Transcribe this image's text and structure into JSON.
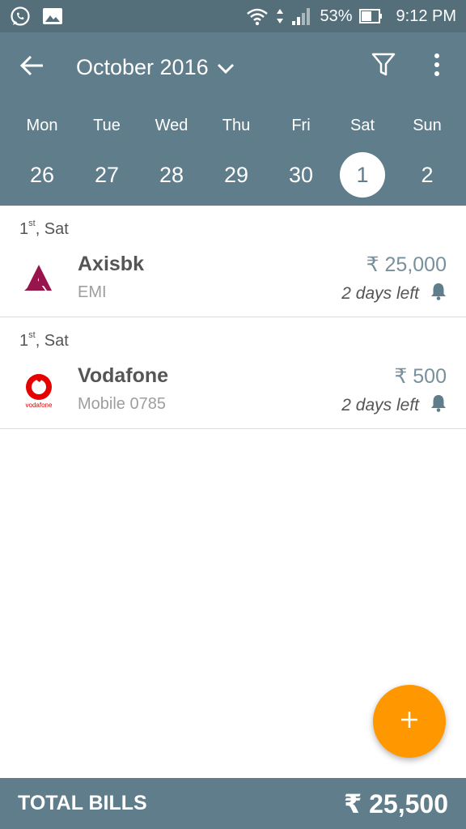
{
  "status_bar": {
    "battery": "53%",
    "time": "9:12 PM",
    "left_icons": [
      "whatsapp-icon",
      "gallery-icon"
    ],
    "right_icons": [
      "wifi-icon",
      "signal-icon",
      "battery-icon"
    ]
  },
  "header": {
    "month": "October 2016",
    "icons": [
      "back-arrow-icon",
      "chevron-down-icon",
      "filter-icon",
      "more-vert-icon"
    ]
  },
  "week": [
    {
      "name": "Mon",
      "num": "26"
    },
    {
      "name": "Tue",
      "num": "27"
    },
    {
      "name": "Wed",
      "num": "28"
    },
    {
      "name": "Thu",
      "num": "29"
    },
    {
      "name": "Fri",
      "num": "30"
    },
    {
      "name": "Sat",
      "num": "1",
      "selected": true
    },
    {
      "name": "Sun",
      "num": "2"
    }
  ],
  "bills": [
    {
      "date_num": "1",
      "date_suffix": "st",
      "date_day": ", Sat",
      "name": "Axisbk",
      "sub": "EMI",
      "amount": "₹ 25,000",
      "due": "2 days left",
      "logo": "axis-bank-logo"
    },
    {
      "date_num": "1",
      "date_suffix": "st",
      "date_day": ", Sat",
      "name": "Vodafone",
      "sub": "Mobile 0785",
      "amount": "₹ 500",
      "due": "2 days left",
      "logo": "vodafone-logo"
    }
  ],
  "footer": {
    "label": "TOTAL BILLS",
    "total": "₹ 25,500"
  },
  "colors": {
    "primary": "#607d8b",
    "statusbar": "#546e7a",
    "accent": "#ff9800",
    "axis": "#97144d",
    "vodafone": "#e60000"
  }
}
